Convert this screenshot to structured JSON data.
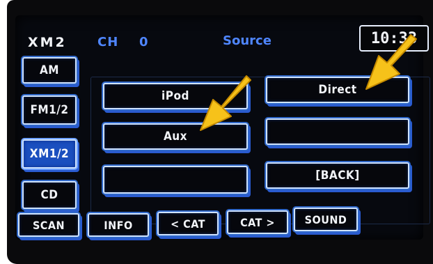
{
  "header": {
    "station": "XM2",
    "channel_label": "CH",
    "channel_value": "0",
    "source_label": "Source",
    "clock": "10:33"
  },
  "side_buttons": [
    {
      "label": "AM",
      "selected": false
    },
    {
      "label": "FM1/2",
      "selected": false
    },
    {
      "label": "XM1/2",
      "selected": true
    },
    {
      "label": "CD",
      "selected": false
    }
  ],
  "source_buttons": {
    "ipod": "iPod",
    "direct": "Direct",
    "aux": "Aux",
    "empty_right_middle": "",
    "empty_left_bottom": "",
    "back": "[BACK]"
  },
  "bottom_buttons": [
    "SCAN",
    "INFO",
    "< CAT",
    "CAT >",
    "SOUND"
  ],
  "colors": {
    "accent_blue": "#2a5bd0",
    "selected_fill": "#1b4fbf",
    "header_blue": "#4f86ff",
    "arrow": "#f6c21a"
  },
  "icons": [
    "pointer-arrow-icon",
    "pointer-arrow-icon"
  ]
}
